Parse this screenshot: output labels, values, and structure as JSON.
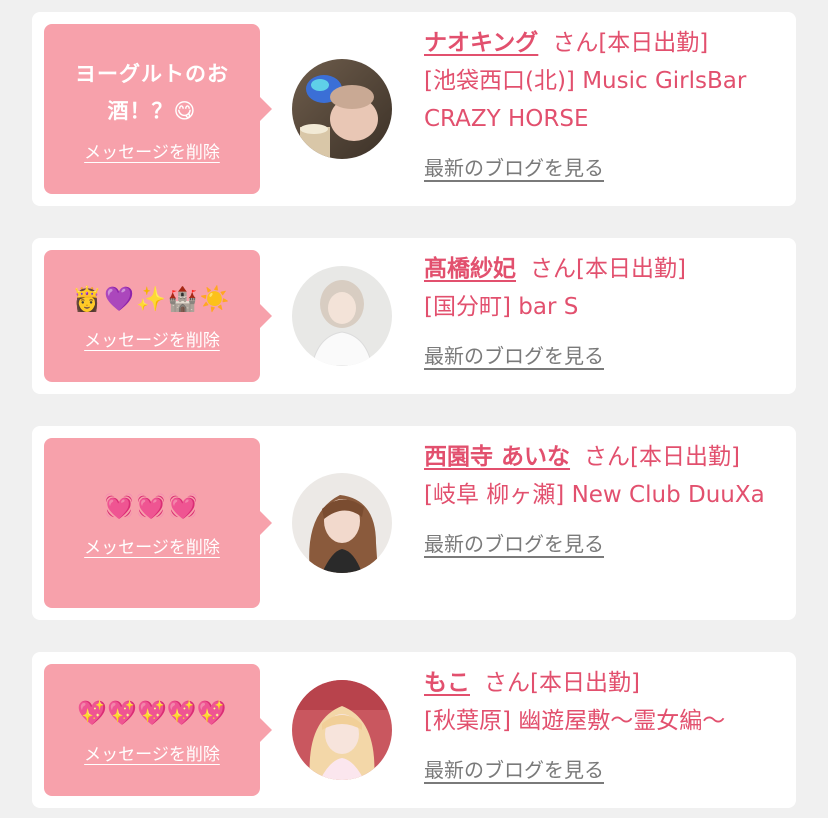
{
  "common": {
    "delete_label": "メッセージを削除",
    "blog_label": "最新のブログを見る",
    "accent_color": "#e2506e",
    "bubble_color": "#f7a1ab"
  },
  "cards": [
    {
      "message": "ヨーグルトのお酒！？😋",
      "name": "ナオキング",
      "suffix": "さん[本日出勤]",
      "shop": "[池袋西口(北)] Music GirlsBar CRAZY HORSE"
    },
    {
      "message": "👸💜✨🏰☀️",
      "name": "髙橋紗妃",
      "suffix": "さん[本日出勤]",
      "shop": "[国分町] bar S"
    },
    {
      "message": "💓💓💓",
      "name": "西園寺 あいな",
      "suffix": "さん[本日出勤]",
      "shop": "[岐阜 柳ヶ瀬] New Club DuuXa"
    },
    {
      "message": "💖💖💖💖💖",
      "name": "もこ",
      "suffix": "さん[本日出勤]",
      "shop": "[秋葉原] 幽遊屋敷〜霊女編〜"
    }
  ]
}
